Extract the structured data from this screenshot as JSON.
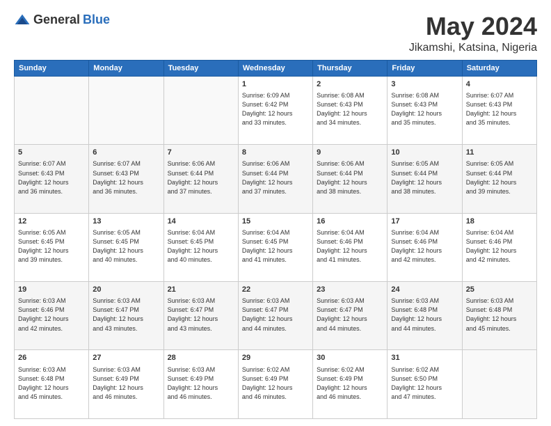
{
  "header": {
    "logo_general": "General",
    "logo_blue": "Blue",
    "title": "May 2024",
    "location": "Jikamshi, Katsina, Nigeria"
  },
  "weekdays": [
    "Sunday",
    "Monday",
    "Tuesday",
    "Wednesday",
    "Thursday",
    "Friday",
    "Saturday"
  ],
  "weeks": [
    [
      {
        "day": "",
        "info": ""
      },
      {
        "day": "",
        "info": ""
      },
      {
        "day": "",
        "info": ""
      },
      {
        "day": "1",
        "info": "Sunrise: 6:09 AM\nSunset: 6:42 PM\nDaylight: 12 hours\nand 33 minutes."
      },
      {
        "day": "2",
        "info": "Sunrise: 6:08 AM\nSunset: 6:43 PM\nDaylight: 12 hours\nand 34 minutes."
      },
      {
        "day": "3",
        "info": "Sunrise: 6:08 AM\nSunset: 6:43 PM\nDaylight: 12 hours\nand 35 minutes."
      },
      {
        "day": "4",
        "info": "Sunrise: 6:07 AM\nSunset: 6:43 PM\nDaylight: 12 hours\nand 35 minutes."
      }
    ],
    [
      {
        "day": "5",
        "info": "Sunrise: 6:07 AM\nSunset: 6:43 PM\nDaylight: 12 hours\nand 36 minutes."
      },
      {
        "day": "6",
        "info": "Sunrise: 6:07 AM\nSunset: 6:43 PM\nDaylight: 12 hours\nand 36 minutes."
      },
      {
        "day": "7",
        "info": "Sunrise: 6:06 AM\nSunset: 6:44 PM\nDaylight: 12 hours\nand 37 minutes."
      },
      {
        "day": "8",
        "info": "Sunrise: 6:06 AM\nSunset: 6:44 PM\nDaylight: 12 hours\nand 37 minutes."
      },
      {
        "day": "9",
        "info": "Sunrise: 6:06 AM\nSunset: 6:44 PM\nDaylight: 12 hours\nand 38 minutes."
      },
      {
        "day": "10",
        "info": "Sunrise: 6:05 AM\nSunset: 6:44 PM\nDaylight: 12 hours\nand 38 minutes."
      },
      {
        "day": "11",
        "info": "Sunrise: 6:05 AM\nSunset: 6:44 PM\nDaylight: 12 hours\nand 39 minutes."
      }
    ],
    [
      {
        "day": "12",
        "info": "Sunrise: 6:05 AM\nSunset: 6:45 PM\nDaylight: 12 hours\nand 39 minutes."
      },
      {
        "day": "13",
        "info": "Sunrise: 6:05 AM\nSunset: 6:45 PM\nDaylight: 12 hours\nand 40 minutes."
      },
      {
        "day": "14",
        "info": "Sunrise: 6:04 AM\nSunset: 6:45 PM\nDaylight: 12 hours\nand 40 minutes."
      },
      {
        "day": "15",
        "info": "Sunrise: 6:04 AM\nSunset: 6:45 PM\nDaylight: 12 hours\nand 41 minutes."
      },
      {
        "day": "16",
        "info": "Sunrise: 6:04 AM\nSunset: 6:46 PM\nDaylight: 12 hours\nand 41 minutes."
      },
      {
        "day": "17",
        "info": "Sunrise: 6:04 AM\nSunset: 6:46 PM\nDaylight: 12 hours\nand 42 minutes."
      },
      {
        "day": "18",
        "info": "Sunrise: 6:04 AM\nSunset: 6:46 PM\nDaylight: 12 hours\nand 42 minutes."
      }
    ],
    [
      {
        "day": "19",
        "info": "Sunrise: 6:03 AM\nSunset: 6:46 PM\nDaylight: 12 hours\nand 42 minutes."
      },
      {
        "day": "20",
        "info": "Sunrise: 6:03 AM\nSunset: 6:47 PM\nDaylight: 12 hours\nand 43 minutes."
      },
      {
        "day": "21",
        "info": "Sunrise: 6:03 AM\nSunset: 6:47 PM\nDaylight: 12 hours\nand 43 minutes."
      },
      {
        "day": "22",
        "info": "Sunrise: 6:03 AM\nSunset: 6:47 PM\nDaylight: 12 hours\nand 44 minutes."
      },
      {
        "day": "23",
        "info": "Sunrise: 6:03 AM\nSunset: 6:47 PM\nDaylight: 12 hours\nand 44 minutes."
      },
      {
        "day": "24",
        "info": "Sunrise: 6:03 AM\nSunset: 6:48 PM\nDaylight: 12 hours\nand 44 minutes."
      },
      {
        "day": "25",
        "info": "Sunrise: 6:03 AM\nSunset: 6:48 PM\nDaylight: 12 hours\nand 45 minutes."
      }
    ],
    [
      {
        "day": "26",
        "info": "Sunrise: 6:03 AM\nSunset: 6:48 PM\nDaylight: 12 hours\nand 45 minutes."
      },
      {
        "day": "27",
        "info": "Sunrise: 6:03 AM\nSunset: 6:49 PM\nDaylight: 12 hours\nand 46 minutes."
      },
      {
        "day": "28",
        "info": "Sunrise: 6:03 AM\nSunset: 6:49 PM\nDaylight: 12 hours\nand 46 minutes."
      },
      {
        "day": "29",
        "info": "Sunrise: 6:02 AM\nSunset: 6:49 PM\nDaylight: 12 hours\nand 46 minutes."
      },
      {
        "day": "30",
        "info": "Sunrise: 6:02 AM\nSunset: 6:49 PM\nDaylight: 12 hours\nand 46 minutes."
      },
      {
        "day": "31",
        "info": "Sunrise: 6:02 AM\nSunset: 6:50 PM\nDaylight: 12 hours\nand 47 minutes."
      },
      {
        "day": "",
        "info": ""
      }
    ]
  ]
}
